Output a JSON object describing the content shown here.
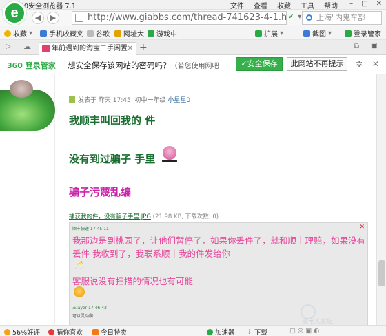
{
  "window": {
    "title": "360安全浏览器 7.1",
    "menus": [
      "文件",
      "查看",
      "收藏",
      "工具",
      "帮助"
    ]
  },
  "address": {
    "url": "http://www.giabbs.com/thread-741623-4-1.ht",
    "search_text": "上海\"内鬼车部"
  },
  "favorites": {
    "items": [
      "收藏",
      "手机收藏夹",
      "谷歌",
      "网址大",
      "游戏中",
      "扩展",
      "截图",
      "登录管家"
    ]
  },
  "tabs": {
    "active_label": "年前遇到的淘宝二手闲置"
  },
  "notice": {
    "brand": "360 登录管家",
    "message": "想安全保存该网站的密码吗？",
    "sub": "（若您使用网吧",
    "save_label": "安全保存",
    "never_label": "此网站不再提示"
  },
  "post": {
    "meta_prefix": "发表于",
    "meta_when": "昨天 17:45",
    "meta_level": "初中一年级",
    "meta_author": "小星星0",
    "line1": "我顺丰叫回我的 件",
    "line2": "没有到过骗子 手里",
    "line3": "骗子污蔑乱编",
    "attach_name": "捕获我的件，没有骗子手里.JPG",
    "attach_size": "(21.98 KB, 下载次数: 0)"
  },
  "chat": {
    "header": "顺丰快递 17:45:11",
    "close": "✕",
    "text1": "我那边是到桃园了，让他们暂停了，如果你丢件了，就和顺丰理赔，如果没有丢件 我收到了，我联系顺丰我的件发给你",
    "text2": "客服说没有扫描的情况也有可能",
    "footer1": "王layer 17:46:42",
    "footer2": "可以灵动啊"
  },
  "watermark": "珠宝人家坛",
  "status": {
    "items": [
      "56%好评",
      "猜你喜欢",
      "今日特卖",
      "加速器",
      "下载"
    ]
  }
}
